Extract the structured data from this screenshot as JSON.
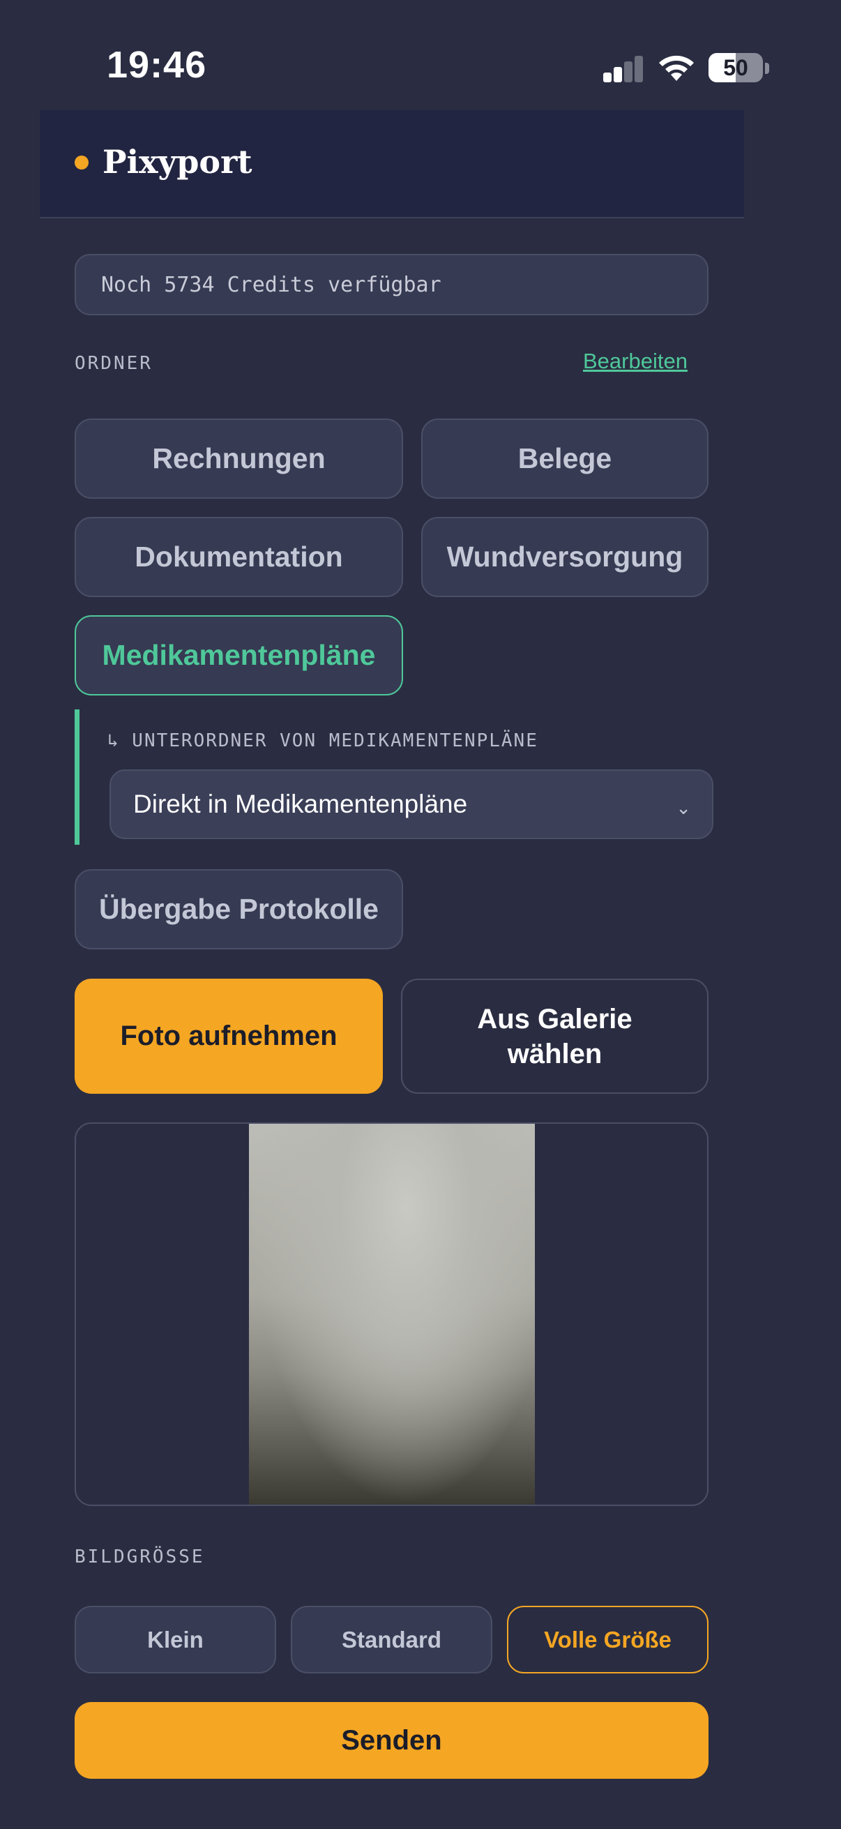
{
  "status_bar": {
    "time": "19:46",
    "battery_level": "50",
    "battery_fraction": 0.5,
    "signal_bars_active": 2,
    "signal_bars_total": 4
  },
  "header": {
    "app_name": "Pixyport",
    "brand_color": "#f5a623"
  },
  "credits": {
    "text": "Noch 5734 Credits verfügbar"
  },
  "folders": {
    "section_label": "ORDNER",
    "edit_label": "Bearbeiten",
    "items": [
      {
        "label": "Rechnungen"
      },
      {
        "label": "Belege"
      },
      {
        "label": "Dokumentation"
      },
      {
        "label": "Wundversorgung"
      },
      {
        "label": "Medikamentenpläne",
        "selected": true
      },
      {
        "label": "Übergabe Protokolle"
      }
    ],
    "subfolder": {
      "label": "↳ UNTERORDNER VON MEDIKAMENTENPLÄNE",
      "selected_value": "Direkt in Medikamentenpläne"
    }
  },
  "actions": {
    "take_photo": "Foto aufnehmen",
    "from_gallery": "Aus Galerie wählen"
  },
  "image_size": {
    "section_label": "BILDGRÖSSE",
    "options": [
      {
        "label": "Klein"
      },
      {
        "label": "Standard"
      },
      {
        "label": "Volle Größe",
        "selected": true
      }
    ]
  },
  "submit": {
    "label": "Senden"
  },
  "colors": {
    "background": "#2a2d41",
    "accent_orange": "#f5a623",
    "accent_green": "#4fc89a"
  }
}
